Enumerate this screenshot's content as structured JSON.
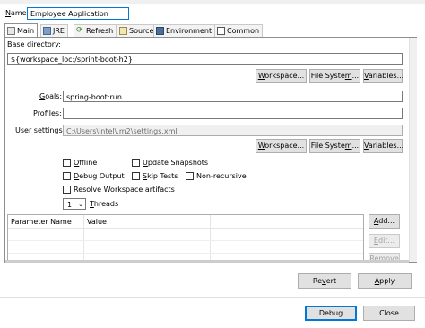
{
  "name": {
    "label": "Name:",
    "value": "Employee Application"
  },
  "tabs": [
    {
      "label": "Main",
      "icon": "main-tab-icon"
    },
    {
      "label": "JRE",
      "icon": "jre-icon"
    },
    {
      "label": "Refresh",
      "icon": "refresh-icon"
    },
    {
      "label": "Source",
      "icon": "source-icon"
    },
    {
      "label": "Environment",
      "icon": "environment-icon"
    },
    {
      "label": "Common",
      "icon": "common-icon"
    }
  ],
  "base_directory": {
    "label": "Base directory:",
    "value": "${workspace_loc:/sprint-boot-h2}",
    "buttons": [
      "Workspace...",
      "File System...",
      "Variables..."
    ]
  },
  "goals": {
    "label": "Goals:",
    "value": "spring-boot:run"
  },
  "profiles": {
    "label": "Profiles:",
    "value": ""
  },
  "user_settings": {
    "label": "User settings:",
    "value": "C:\\Users\\intel\\.m2\\settings.xml",
    "buttons": [
      "Workspace...",
      "File System...",
      "Variables..."
    ]
  },
  "options": {
    "offline": "Offline",
    "update_snapshots": "Update Snapshots",
    "debug_output": "Debug Output",
    "skip_tests": "Skip Tests",
    "non_recursive": "Non-recursive",
    "resolve_workspace": "Resolve Workspace artifacts"
  },
  "threads": {
    "value": "1",
    "label": "Threads"
  },
  "params_table": {
    "columns": [
      "Parameter Name",
      "Value"
    ],
    "buttons": [
      "Add...",
      "Edit...",
      "Remove"
    ]
  },
  "footer": {
    "revert": "Revert",
    "apply": "Apply",
    "debug": "Debug",
    "close": "Close"
  },
  "colors": {
    "focus_border": "#0078d7",
    "window_bg": "#f0f0f0"
  }
}
